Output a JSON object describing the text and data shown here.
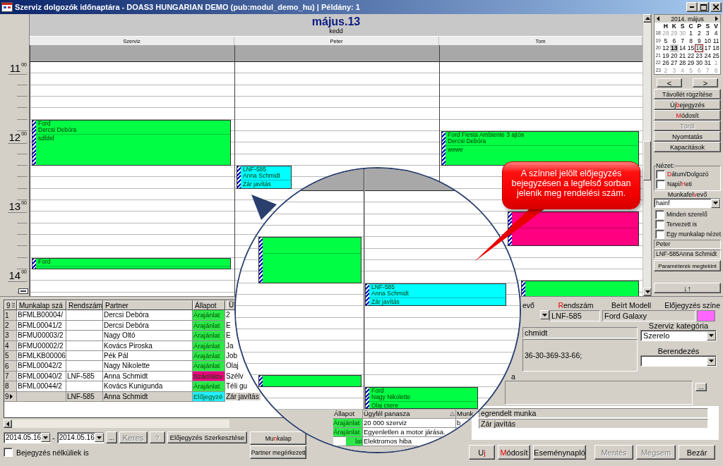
{
  "window": {
    "title": "Szerviz dolgozók időnaptára - DOAS3 HUNGARIAN DEMO (pub:modul_demo_hu) | Példány: 1"
  },
  "calendar": {
    "date": "május.13",
    "weekday": "kedd",
    "hours": [
      {
        "hour": "11",
        "minutes": "00"
      },
      {
        "hour": "12",
        "minutes": "00"
      },
      {
        "hour": "13",
        "minutes": "00"
      },
      {
        "hour": "14",
        "minutes": "00"
      }
    ],
    "columns": [
      {
        "name": "Szerviz",
        "events": [
          {
            "lines": [
              "Ford",
              "Dercsi Debóra"
            ],
            "note": "sdfdsf",
            "color": "#00ff44"
          },
          {
            "lines": [
              "Ford"
            ],
            "color": "#00ff44"
          }
        ]
      },
      {
        "name": "Peter",
        "events": [
          {
            "lines": [
              "LNF-585",
              "Anna Schmidt"
            ],
            "note": "Zár javítás",
            "color": "#00ffff"
          }
        ]
      },
      {
        "name": "Tom",
        "events": [
          {
            "lines": [
              "Ford Fiesta Ambiente 3 ajtós",
              "Dercsi Debóra"
            ],
            "note": "wewe",
            "color": "#00ff44"
          },
          {
            "color": "#ff0080"
          },
          {
            "color": "#00ff44"
          }
        ]
      }
    ]
  },
  "minicalendar": {
    "title": "2014. május",
    "weekdays": [
      "H",
      "K",
      "S",
      "C",
      "P",
      "S",
      "V"
    ],
    "weeks": [
      {
        "number": "18",
        "days": [
          {
            "day": "28",
            "muted": true,
            "today": false,
            "selected": false
          },
          {
            "day": "29",
            "muted": true,
            "today": false,
            "selected": false
          },
          {
            "day": "30",
            "muted": true,
            "today": false,
            "selected": false
          },
          {
            "day": "1",
            "muted": false,
            "today": false,
            "selected": false
          },
          {
            "day": "2",
            "muted": false,
            "today": false,
            "selected": false
          },
          {
            "day": "3",
            "muted": false,
            "today": false,
            "selected": false
          },
          {
            "day": "4",
            "muted": false,
            "today": false,
            "selected": false
          }
        ]
      },
      {
        "number": "19",
        "days": [
          {
            "day": "5",
            "muted": false,
            "today": false,
            "selected": false
          },
          {
            "day": "6",
            "muted": false,
            "today": false,
            "selected": false
          },
          {
            "day": "7",
            "muted": false,
            "today": false,
            "selected": false
          },
          {
            "day": "8",
            "muted": false,
            "today": false,
            "selected": false
          },
          {
            "day": "9",
            "muted": false,
            "today": false,
            "selected": false
          },
          {
            "day": "10",
            "muted": false,
            "today": false,
            "selected": false
          },
          {
            "day": "11",
            "muted": false,
            "today": false,
            "selected": false
          }
        ]
      },
      {
        "number": "20",
        "days": [
          {
            "day": "12",
            "muted": false,
            "today": false,
            "selected": false
          },
          {
            "day": "13",
            "muted": false,
            "today": true,
            "selected": false
          },
          {
            "day": "14",
            "muted": false,
            "today": false,
            "selected": false
          },
          {
            "day": "15",
            "muted": false,
            "today": false,
            "selected": false
          },
          {
            "day": "16",
            "muted": false,
            "today": false,
            "selected": true
          },
          {
            "day": "17",
            "muted": false,
            "today": false,
            "selected": false
          },
          {
            "day": "18",
            "muted": false,
            "today": false,
            "selected": false
          }
        ]
      },
      {
        "number": "21",
        "days": [
          {
            "day": "19",
            "muted": false,
            "today": false,
            "selected": false
          },
          {
            "day": "20",
            "muted": false,
            "today": false,
            "selected": false
          },
          {
            "day": "21",
            "muted": false,
            "today": false,
            "selected": false
          },
          {
            "day": "22",
            "muted": false,
            "today": false,
            "selected": false
          },
          {
            "day": "23",
            "muted": false,
            "today": false,
            "selected": false
          },
          {
            "day": "24",
            "muted": false,
            "today": false,
            "selected": false
          },
          {
            "day": "25",
            "muted": false,
            "today": false,
            "selected": false
          }
        ]
      },
      {
        "number": "22",
        "days": [
          {
            "day": "26",
            "muted": false,
            "today": false,
            "selected": false
          },
          {
            "day": "27",
            "muted": false,
            "today": false,
            "selected": false
          },
          {
            "day": "28",
            "muted": false,
            "today": false,
            "selected": false
          },
          {
            "day": "29",
            "muted": false,
            "today": false,
            "selected": false
          },
          {
            "day": "30",
            "muted": false,
            "today": false,
            "selected": false
          },
          {
            "day": "31",
            "muted": false,
            "today": false,
            "selected": false
          },
          {
            "day": "1",
            "muted": true,
            "today": false,
            "selected": false
          }
        ]
      },
      {
        "number": "23",
        "days": [
          {
            "day": "2",
            "muted": true,
            "today": false,
            "selected": false
          },
          {
            "day": "3",
            "muted": true,
            "today": false,
            "selected": false
          },
          {
            "day": "4",
            "muted": true,
            "today": false,
            "selected": false
          },
          {
            "day": "5",
            "muted": true,
            "today": false,
            "selected": false
          },
          {
            "day": "6",
            "muted": true,
            "today": false,
            "selected": false
          },
          {
            "day": "7",
            "muted": true,
            "today": false,
            "selected": false
          },
          {
            "day": "8",
            "muted": true,
            "today": false,
            "selected": false
          }
        ]
      }
    ]
  },
  "panel": {
    "nav_buttons": [
      {
        "label": "<",
        "disabled": false
      },
      {
        "label": ">",
        "disabled": false
      }
    ],
    "buttons": [
      {
        "label": "Távollét rögzítése",
        "disabled": false
      },
      {
        "label": {
          "before": "Új ",
          "key": "b",
          "after": "ejegyzés"
        },
        "disabled": false
      },
      {
        "label": {
          "key": "M",
          "after": "ódosít"
        },
        "disabled": false
      },
      {
        "label": "Töröl",
        "disabled": true
      },
      {
        "label": "Nyomtatás",
        "disabled": false
      },
      {
        "label": "Kapacitások",
        "disabled": false
      }
    ],
    "view_group": {
      "title": "Nézet:",
      "options": [
        {
          "label": {
            "key": "D",
            "after": "átum/Dolgozó"
          },
          "checked": false
        },
        {
          "label": {
            "before": "Napi/",
            "key": "H",
            "after": "eti"
          },
          "checked": false
        }
      ]
    },
    "receiver_label": {
      "before": "Munkafel",
      "key": "v",
      "after": "evő"
    },
    "receiver": "hainf",
    "options": [
      {
        "label": "Minden szerelő",
        "checked": false
      },
      {
        "label": "Tervezett is",
        "checked": false
      },
      {
        "label": "Egy munkalap nézet",
        "checked": false
      }
    ],
    "info_fields": [
      "Peter",
      "LNF-585Anna Schmidt"
    ],
    "params_button": {
      "label": "Paraméterek megtekint",
      "disabled": false
    },
    "sort_button": {
      "label": "↓↑",
      "disabled": false
    }
  },
  "jobs": {
    "columns": [
      "9",
      "Munkalap szá",
      "Rendszám",
      "Partner",
      "Állapot",
      "Ü"
    ],
    "rows": [
      {
        "number": "1",
        "worksheet": "BFMLB00004/",
        "partner": "Dercsi Debóra",
        "status": "Árajánlat",
        "color": "#2ee84a",
        "complaint": "2",
        "selected": false
      },
      {
        "number": "2",
        "worksheet": "BFML00041/2",
        "partner": "Dercsi Debóra",
        "status": "Árajánlat",
        "color": "#2ee84a",
        "complaint": "E",
        "selected": false
      },
      {
        "number": "3",
        "worksheet": "BFMU00003/2",
        "partner": "Nagy Oltó",
        "status": "Árajánlat",
        "color": "#2ee84a",
        "complaint": "E",
        "selected": false
      },
      {
        "number": "4",
        "worksheet": "BFMU00002/2",
        "partner": "Kovács Piroska",
        "status": "Árajánlat",
        "color": "#2ee84a",
        "complaint": "Ja",
        "selected": false
      },
      {
        "number": "5",
        "worksheet": "BFMLKB00006",
        "partner": "Pék Pál",
        "status": "Árajánlat",
        "color": "#2ee84a",
        "complaint": "Job",
        "selected": false
      },
      {
        "number": "6",
        "worksheet": "BFML00042/2",
        "partner": "Nagy Nikolette",
        "status": "Árajánlat",
        "color": "#2ee84a",
        "complaint": "Olaj",
        "selected": false
      },
      {
        "number": "7",
        "worksheet": "BFML00040/2",
        "plate": "LNF-585",
        "partner": "Anna Schmidt",
        "status": "Számlázv",
        "color": "#e8007c",
        "complaint": "Szélv",
        "selected": false
      },
      {
        "number": "8",
        "worksheet": "BFML00044/2",
        "partner": "Kovács Kunigunda",
        "status": "Árajánlat",
        "color": "#2ee84a",
        "complaint": "Téli gu",
        "selected": false
      },
      {
        "number": "9",
        "plate": "LNF-585",
        "partner": "Anna Schmidt",
        "status": "Előjegyzé",
        "color": "#22eeff",
        "complaint": "Zár javítás",
        "selected": true
      }
    ]
  },
  "filters": {
    "date_from": "2014.05.16",
    "separator": "-",
    "date_to": "2014.05.16",
    "buttons": [
      {
        "label": "...",
        "disabled": false
      },
      {
        "label": "Keres",
        "disabled": true
      },
      {
        "label": "?",
        "disabled": true
      },
      {
        "label": "Előjegyzés Szerkesztése",
        "disabled": false
      }
    ],
    "side_buttons": [
      {
        "label": {
          "before": "Mu",
          "key": "n",
          "after": "kalap"
        },
        "disabled": false
      },
      {
        "label": "Partner megérkezett",
        "disabled": false
      }
    ],
    "checkbox": {
      "label": "Bejegyzés nélküliek is",
      "checked": false
    }
  },
  "detail": {
    "receiver_label": "evő",
    "plate_label": {
      "key": "R",
      "after": "endszám"
    },
    "plate": "LNF-585",
    "model_label": "Beírt Modell",
    "model": "Ford Galaxy",
    "color_label": "Előjegyzés színe",
    "color": "#ff66ff",
    "customer": "chmidt",
    "contact": "36-30-369-33-66;",
    "category_label": "Szerviz kategória",
    "category": "Szerelo",
    "equipment_label": "Berendezés",
    "note_label": "a",
    "more_button": {
      "label": "...",
      "disabled": false
    },
    "work_rows": [
      "egrendelt munka",
      "Zár javítás"
    ],
    "buttons": [
      {
        "label": {
          "before": "U",
          "key": "j"
        },
        "disabled": false
      },
      {
        "label": {
          "key": "M",
          "after": "ódosít"
        },
        "disabled": false
      },
      {
        "label": "Eseménynapló",
        "disabled": false
      },
      {
        "label": "Mentés",
        "disabled": true
      },
      {
        "label": "Mégsem",
        "disabled": true
      },
      {
        "label": "Bezár",
        "disabled": false
      }
    ]
  },
  "magnifier": {
    "columns": [
      {
        "events": [
          {
            "color": "#00ff44"
          },
          {
            "color": "#00ff44"
          }
        ]
      },
      {
        "events": [
          {
            "lines": [
              "LNF-585",
              "Anna Schmidt"
            ],
            "note": "Zár javítás",
            "color": "#00ffff"
          },
          {
            "lines": [
              "Ford",
              "Nagy Nikolette"
            ],
            "note": "Olaj csere",
            "color": "#00ff44"
          }
        ]
      }
    ],
    "table": {
      "columns": [
        "Állapot",
        "Ügyfél panasza",
        "Munk"
      ],
      "rows": [
        {
          "status": "Árajánlat",
          "color": "#2ee84a",
          "complaint": "20 000 szerviz",
          "work": "b"
        },
        {
          "status": "Árajánlat",
          "color": "#2ee84a",
          "complaint": "Egyenletlen a motor járása."
        },
        {
          "status": "lat",
          "color": "#2ee84a",
          "complaint": "Elektromos hiba"
        }
      ]
    }
  },
  "callout": {
    "text": "A színnel jelölt előjegyzés bejegyzésen a legfelső sorban jelenik meg rendelési szám."
  }
}
